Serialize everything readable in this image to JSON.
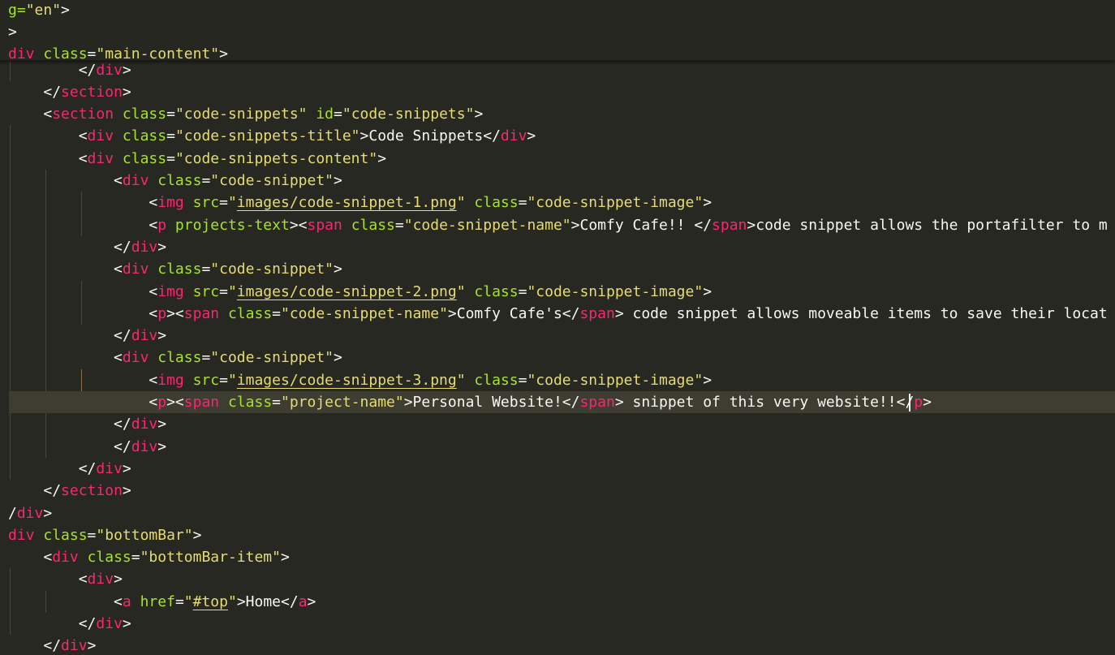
{
  "editor": {
    "language": "html",
    "theme": "monokai",
    "colors": {
      "background": "#272822",
      "current_line": "#3e3d32",
      "tag": "#f92672",
      "attribute": "#a6e22e",
      "string": "#e6db74",
      "punctuation": "#f8f8f2"
    }
  },
  "sticky_header": [
    {
      "tokens": [
        [
          "g=",
          "a"
        ],
        [
          "\"en\"",
          "s"
        ],
        [
          ">",
          "p"
        ]
      ]
    },
    {
      "tokens": [
        [
          ">",
          "p"
        ]
      ]
    },
    {
      "tokens": [
        [
          "div",
          "t"
        ],
        [
          " ",
          "p"
        ],
        [
          "class",
          "a"
        ],
        [
          "=",
          "p"
        ],
        [
          "\"main-content\"",
          "s"
        ],
        [
          ">",
          "p"
        ]
      ]
    }
  ],
  "lines": [
    {
      "tokens": [
        [
          "        ",
          "p"
        ],
        [
          "</",
          "p"
        ],
        [
          "div",
          "t"
        ],
        [
          ">",
          "p"
        ]
      ]
    },
    {
      "tokens": [
        [
          "    ",
          "p"
        ],
        [
          "</",
          "p"
        ],
        [
          "section",
          "t"
        ],
        [
          ">",
          "p"
        ]
      ]
    },
    {
      "tokens": [
        [
          "    ",
          "p"
        ],
        [
          "<",
          "p"
        ],
        [
          "section",
          "t"
        ],
        [
          " ",
          "p"
        ],
        [
          "class",
          "a"
        ],
        [
          "=",
          "p"
        ],
        [
          "\"code-snippets\"",
          "s"
        ],
        [
          " ",
          "p"
        ],
        [
          "id",
          "a"
        ],
        [
          "=",
          "p"
        ],
        [
          "\"code-snippets\"",
          "s"
        ],
        [
          ">",
          "p"
        ]
      ]
    },
    {
      "tokens": [
        [
          "        ",
          "p"
        ],
        [
          "<",
          "p"
        ],
        [
          "div",
          "t"
        ],
        [
          " ",
          "p"
        ],
        [
          "class",
          "a"
        ],
        [
          "=",
          "p"
        ],
        [
          "\"code-snippets-title\"",
          "s"
        ],
        [
          ">Code Snippets</",
          "p"
        ],
        [
          "div",
          "t"
        ],
        [
          ">",
          "p"
        ]
      ]
    },
    {
      "tokens": [
        [
          "        ",
          "p"
        ],
        [
          "<",
          "p"
        ],
        [
          "div",
          "t"
        ],
        [
          " ",
          "p"
        ],
        [
          "class",
          "a"
        ],
        [
          "=",
          "p"
        ],
        [
          "\"code-snippets-content\"",
          "s"
        ],
        [
          ">",
          "p"
        ]
      ]
    },
    {
      "tokens": [
        [
          "            ",
          "p"
        ],
        [
          "<",
          "p"
        ],
        [
          "div",
          "t"
        ],
        [
          " ",
          "p"
        ],
        [
          "class",
          "a"
        ],
        [
          "=",
          "p"
        ],
        [
          "\"code-snippet\"",
          "s"
        ],
        [
          ">",
          "p"
        ]
      ]
    },
    {
      "tokens": [
        [
          "                ",
          "p"
        ],
        [
          "<",
          "p"
        ],
        [
          "img",
          "t"
        ],
        [
          " ",
          "p"
        ],
        [
          "src",
          "a"
        ],
        [
          "=",
          "p"
        ],
        [
          "\"",
          "s"
        ],
        [
          "images/code-snippet-1.png",
          "su"
        ],
        [
          "\"",
          "s"
        ],
        [
          " ",
          "p"
        ],
        [
          "class",
          "a"
        ],
        [
          "=",
          "p"
        ],
        [
          "\"code-snippet-image\"",
          "s"
        ],
        [
          ">",
          "p"
        ]
      ]
    },
    {
      "tokens": [
        [
          "                ",
          "p"
        ],
        [
          "<",
          "p"
        ],
        [
          "p",
          "t"
        ],
        [
          " ",
          "p"
        ],
        [
          "projects-text",
          "a"
        ],
        [
          "><",
          "p"
        ],
        [
          "span",
          "t"
        ],
        [
          " ",
          "p"
        ],
        [
          "class",
          "a"
        ],
        [
          "=",
          "p"
        ],
        [
          "\"code-snippet-name\"",
          "s"
        ],
        [
          ">Comfy Cafe!! </",
          "p"
        ],
        [
          "span",
          "t"
        ],
        [
          ">code snippet allows the portafilter to m",
          "p"
        ]
      ]
    },
    {
      "tokens": [
        [
          "            ",
          "p"
        ],
        [
          "</",
          "p"
        ],
        [
          "div",
          "t"
        ],
        [
          ">",
          "p"
        ]
      ]
    },
    {
      "tokens": [
        [
          "            ",
          "p"
        ],
        [
          "<",
          "p"
        ],
        [
          "div",
          "t"
        ],
        [
          " ",
          "p"
        ],
        [
          "class",
          "a"
        ],
        [
          "=",
          "p"
        ],
        [
          "\"code-snippet\"",
          "s"
        ],
        [
          ">",
          "p"
        ]
      ]
    },
    {
      "tokens": [
        [
          "                ",
          "p"
        ],
        [
          "<",
          "p"
        ],
        [
          "img",
          "t"
        ],
        [
          " ",
          "p"
        ],
        [
          "src",
          "a"
        ],
        [
          "=",
          "p"
        ],
        [
          "\"",
          "s"
        ],
        [
          "images/code-snippet-2.png",
          "su"
        ],
        [
          "\"",
          "s"
        ],
        [
          " ",
          "p"
        ],
        [
          "class",
          "a"
        ],
        [
          "=",
          "p"
        ],
        [
          "\"code-snippet-image\"",
          "s"
        ],
        [
          ">",
          "p"
        ]
      ]
    },
    {
      "tokens": [
        [
          "                ",
          "p"
        ],
        [
          "<",
          "p"
        ],
        [
          "p",
          "t"
        ],
        [
          "><",
          "p"
        ],
        [
          "span",
          "t"
        ],
        [
          " ",
          "p"
        ],
        [
          "class",
          "a"
        ],
        [
          "=",
          "p"
        ],
        [
          "\"code-snippet-name\"",
          "s"
        ],
        [
          ">Comfy Cafe's</",
          "p"
        ],
        [
          "span",
          "t"
        ],
        [
          "> code snippet allows moveable items to save their locat",
          "p"
        ]
      ]
    },
    {
      "tokens": [
        [
          "            ",
          "p"
        ],
        [
          "</",
          "p"
        ],
        [
          "div",
          "t"
        ],
        [
          ">",
          "p"
        ]
      ]
    },
    {
      "tokens": [
        [
          "            ",
          "p"
        ],
        [
          "<",
          "p"
        ],
        [
          "div",
          "t"
        ],
        [
          " ",
          "p"
        ],
        [
          "class",
          "a"
        ],
        [
          "=",
          "p"
        ],
        [
          "\"code-snippet\"",
          "s"
        ],
        [
          ">",
          "p"
        ]
      ]
    },
    {
      "tokens": [
        [
          "                ",
          "p"
        ],
        [
          "<",
          "p"
        ],
        [
          "img",
          "t"
        ],
        [
          " ",
          "p"
        ],
        [
          "src",
          "a"
        ],
        [
          "=",
          "p"
        ],
        [
          "\"",
          "s"
        ],
        [
          "images/code-snippet-3.png",
          "su"
        ],
        [
          "\"",
          "s"
        ],
        [
          " ",
          "p"
        ],
        [
          "class",
          "a"
        ],
        [
          "=",
          "p"
        ],
        [
          "\"code-snippet-image\"",
          "s"
        ],
        [
          ">",
          "p"
        ]
      ]
    },
    {
      "current": true,
      "tokens": [
        [
          "                ",
          "p"
        ],
        [
          "<",
          "p"
        ],
        [
          "p",
          "t"
        ],
        [
          "><",
          "p"
        ],
        [
          "span",
          "t"
        ],
        [
          " ",
          "p"
        ],
        [
          "class",
          "a"
        ],
        [
          "=",
          "p"
        ],
        [
          "\"project-name\"",
          "s"
        ],
        [
          ">Personal Website!</",
          "p"
        ],
        [
          "span",
          "t"
        ],
        [
          "> snippet of this very website!!",
          "p"
        ],
        [
          "</",
          "p"
        ],
        [
          "p",
          "t"
        ],
        [
          ">",
          "p"
        ]
      ]
    },
    {
      "tokens": [
        [
          "            ",
          "p"
        ],
        [
          "</",
          "p"
        ],
        [
          "div",
          "t"
        ],
        [
          ">",
          "p"
        ]
      ]
    },
    {
      "tokens": [
        [
          "            ",
          "p"
        ],
        [
          "</",
          "p"
        ],
        [
          "div",
          "t"
        ],
        [
          ">",
          "p"
        ]
      ]
    },
    {
      "tokens": [
        [
          "        ",
          "p"
        ],
        [
          "</",
          "p"
        ],
        [
          "div",
          "t"
        ],
        [
          ">",
          "p"
        ]
      ]
    },
    {
      "tokens": [
        [
          "    ",
          "p"
        ],
        [
          "</",
          "p"
        ],
        [
          "section",
          "t"
        ],
        [
          ">",
          "p"
        ]
      ]
    },
    {
      "tokens": [
        [
          "/",
          "p"
        ],
        [
          "div",
          "t"
        ],
        [
          ">",
          "p"
        ]
      ]
    },
    {
      "tokens": [
        [
          "div",
          "t"
        ],
        [
          " ",
          "p"
        ],
        [
          "class",
          "a"
        ],
        [
          "=",
          "p"
        ],
        [
          "\"bottomBar\"",
          "s"
        ],
        [
          ">",
          "p"
        ]
      ]
    },
    {
      "tokens": [
        [
          "    ",
          "p"
        ],
        [
          "<",
          "p"
        ],
        [
          "div",
          "t"
        ],
        [
          " ",
          "p"
        ],
        [
          "class",
          "a"
        ],
        [
          "=",
          "p"
        ],
        [
          "\"bottomBar-item\"",
          "s"
        ],
        [
          ">",
          "p"
        ]
      ]
    },
    {
      "tokens": [
        [
          "        ",
          "p"
        ],
        [
          "<",
          "p"
        ],
        [
          "div",
          "t"
        ],
        [
          ">",
          "p"
        ]
      ]
    },
    {
      "tokens": [
        [
          "            ",
          "p"
        ],
        [
          "<",
          "p"
        ],
        [
          "a",
          "t"
        ],
        [
          " ",
          "p"
        ],
        [
          "href",
          "a"
        ],
        [
          "=",
          "p"
        ],
        [
          "\"",
          "s"
        ],
        [
          "#top",
          "su"
        ],
        [
          "\"",
          "s"
        ],
        [
          ">Home</",
          "p"
        ],
        [
          "a",
          "t"
        ],
        [
          ">",
          "p"
        ]
      ]
    },
    {
      "tokens": [
        [
          "        ",
          "p"
        ],
        [
          "</",
          "p"
        ],
        [
          "div",
          "t"
        ],
        [
          ">",
          "p"
        ]
      ]
    },
    {
      "tokens": [
        [
          "    ",
          "p"
        ],
        [
          "</",
          "p"
        ],
        [
          "div",
          "t"
        ],
        [
          ">",
          "p"
        ]
      ]
    }
  ]
}
